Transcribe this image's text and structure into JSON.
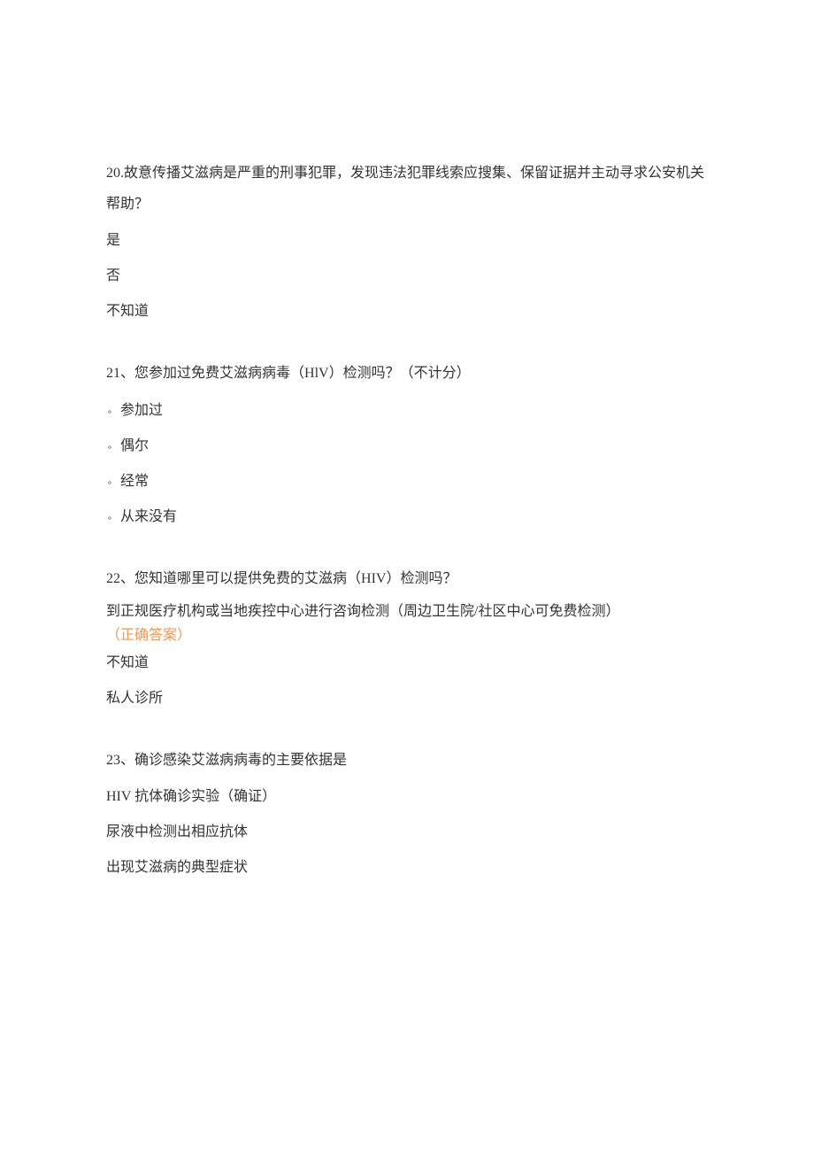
{
  "questions": [
    {
      "number": "20",
      "separator": ".",
      "text": "故意传播艾滋病是严重的刑事犯罪，发现违法犯罪线索应搜集、保留证据并主动寻求公安机关帮助？",
      "options": [
        "是",
        "否",
        "不知道"
      ]
    },
    {
      "number": "21",
      "separator": "、",
      "text": "您参加过免费艾滋病病毒（HlV）检测吗？（不计分）",
      "bulletOptions": [
        "参加过",
        "偶尔",
        "经常",
        "从来没有"
      ]
    },
    {
      "number": "22",
      "separator": "、",
      "text": "您知道哪里可以提供免费的艾滋病（HIV）检测吗？",
      "optionWithCorrect": "到正规医疗机构或当地疾控中心进行咨询检测（周边卫生院/社区中心可免费检测）",
      "correctLabel": "（正确答案）",
      "laterOptions": [
        "不知道",
        "私人诊所"
      ]
    },
    {
      "number": "23",
      "separator": "、",
      "text": "确诊感染艾滋病病毒的主要依据是",
      "options": [
        "HIV 抗体确诊实验（确证）",
        "尿液中检测出相应抗体",
        "出现艾滋病的典型症状"
      ]
    }
  ]
}
